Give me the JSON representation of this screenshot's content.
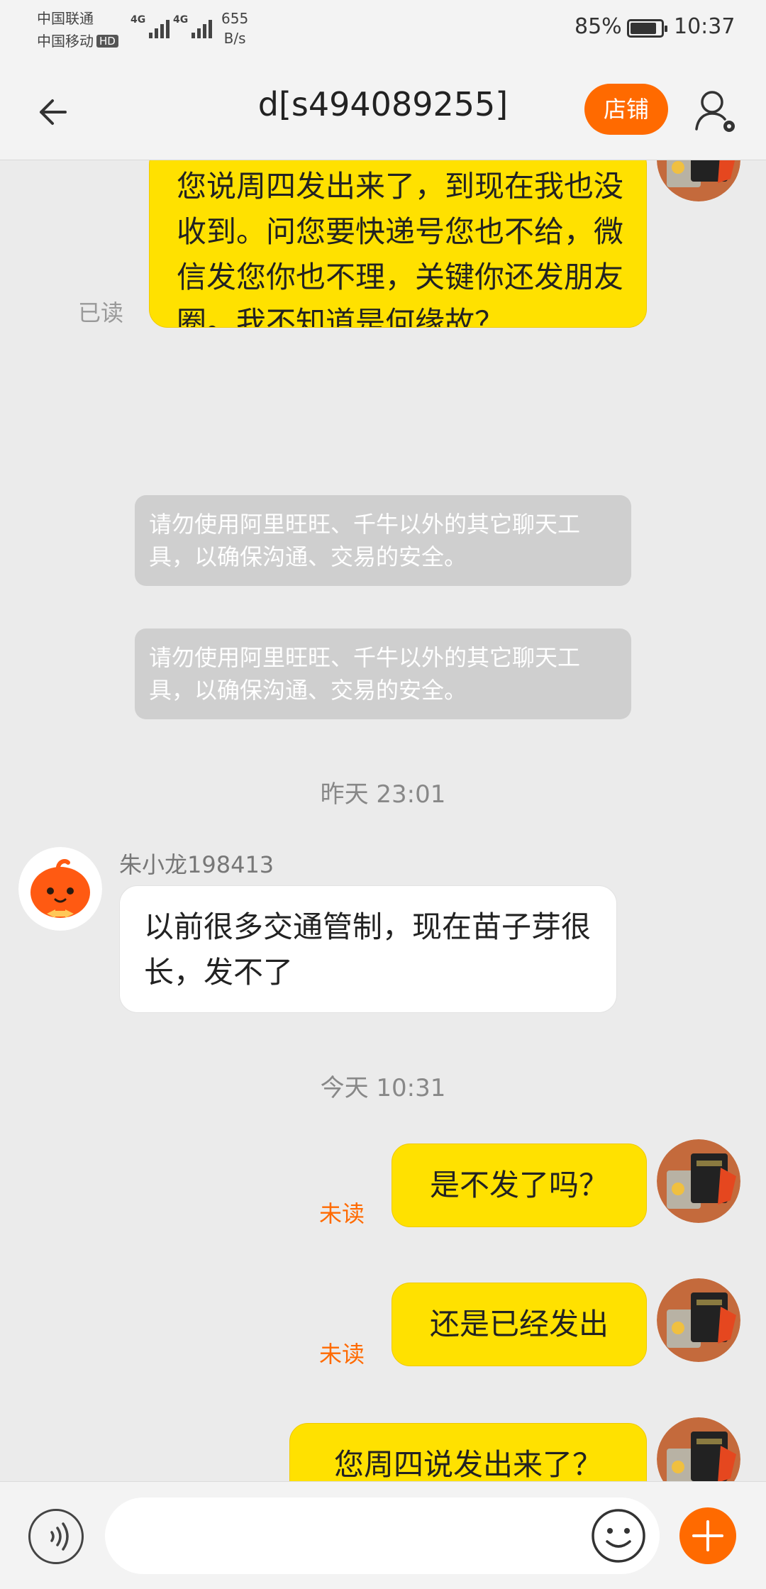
{
  "status_bar": {
    "carrier_1": "中国联通",
    "carrier_2": "中国移动",
    "hd_badge": "HD",
    "network_1": "4G",
    "network_2": "4G",
    "speed_value": "655",
    "speed_unit": "B/s",
    "battery_percent": "85%",
    "battery_level": 0.85,
    "time": "10:37"
  },
  "header": {
    "title": "d[s494089255]",
    "shop_button": "店铺"
  },
  "chat": {
    "messages": [
      {
        "side": "mine",
        "text": "朱总您好，我知道这段时间您忙。您说周四发出来了，到现在我也没收到。问您要快递号您也不给，微信发您你也不理，关键你还发朋友圈。我不知道是何缘故？",
        "status": "已读"
      },
      {
        "type": "notice",
        "text": "请勿使用阿里旺旺、千牛以外的其它聊天工具，以确保沟通、交易的安全。"
      },
      {
        "type": "notice",
        "text": "请勿使用阿里旺旺、千牛以外的其它聊天工具，以确保沟通、交易的安全。"
      },
      {
        "type": "timestamp",
        "text": "昨天  23:01"
      },
      {
        "side": "theirs",
        "sender": "朱小龙198413",
        "text": "以前很多交通管制，现在苗子芽很长，发不了"
      },
      {
        "type": "timestamp",
        "text": "今天  10:31"
      },
      {
        "side": "mine",
        "text": "是不发了吗？",
        "status": "未读"
      },
      {
        "side": "mine",
        "text": "还是已经发出",
        "status": "未读"
      },
      {
        "side": "mine",
        "text": "您周四说发出来了？"
      }
    ]
  },
  "input_bar": {
    "placeholder": ""
  },
  "colors": {
    "accent": "#ff6a00",
    "my_bubble": "#ffe100",
    "their_bubble": "#ffffff",
    "notice_bg": "#cfcfcf",
    "chat_bg": "#ebebeb",
    "unread": "#ff6a00",
    "read": "#999999"
  },
  "icons": {
    "back": "arrow-left-icon",
    "user_settings": "user-gear-icon",
    "voice": "voice-wave-icon",
    "emoji": "smiley-icon",
    "plus": "plus-icon"
  }
}
